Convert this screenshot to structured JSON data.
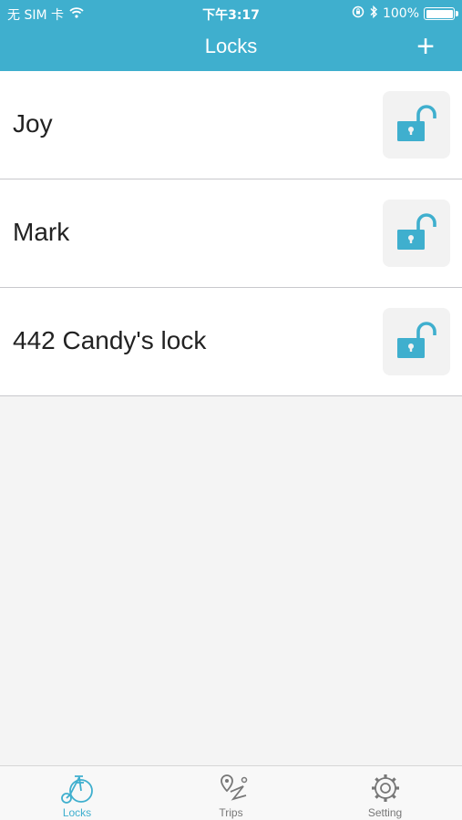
{
  "status_bar": {
    "carrier": "无 SIM 卡",
    "time": "下午3:17",
    "battery": "100%",
    "battery_level": 1.0
  },
  "nav": {
    "title": "Locks",
    "add_label": "+"
  },
  "locks": [
    {
      "name": "Joy",
      "icon": "unlocked-padlock-icon"
    },
    {
      "name": "Mark",
      "icon": "unlocked-padlock-icon"
    },
    {
      "name": "442 Candy's lock",
      "icon": "unlocked-padlock-icon"
    }
  ],
  "tabs": [
    {
      "label": "Locks",
      "icon": "bicycle-icon",
      "active": true
    },
    {
      "label": "Trips",
      "icon": "map-route-icon",
      "active": false
    },
    {
      "label": "Setting",
      "icon": "gear-icon",
      "active": false
    }
  ],
  "colors": {
    "accent": "#3fafce",
    "background": "#f4f4f4",
    "inactive_tab": "#777777"
  }
}
